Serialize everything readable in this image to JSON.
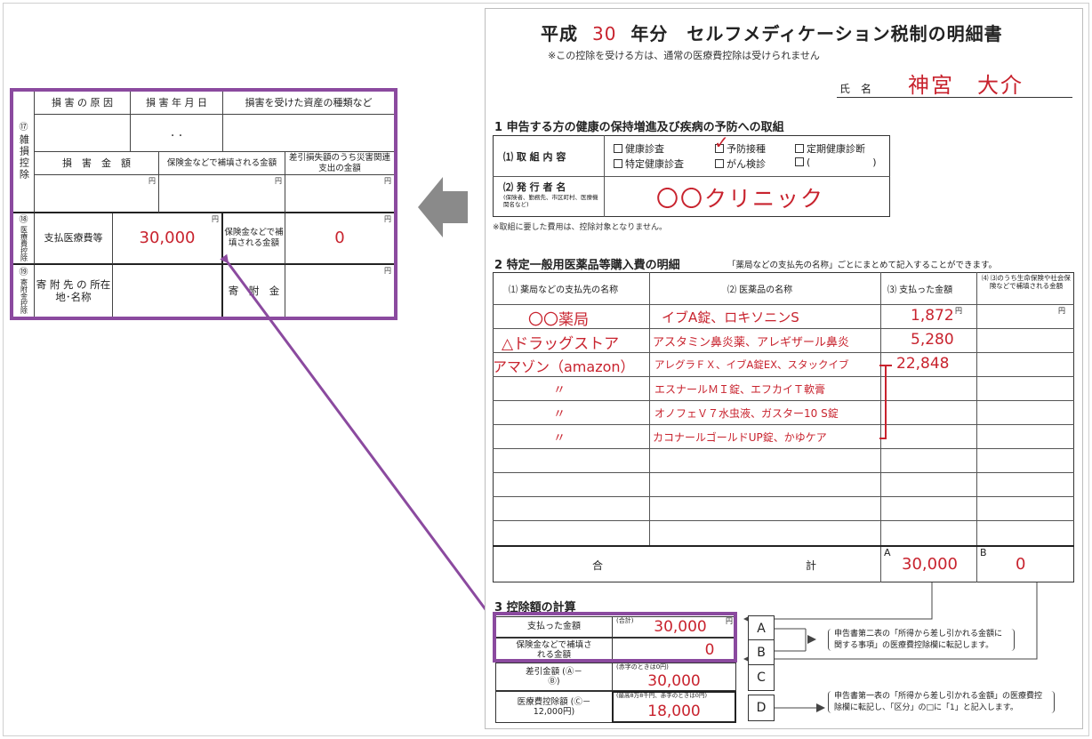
{
  "excerpt": {
    "row17": {
      "number": "⑰",
      "label": "雑損控除",
      "col_cause": "損 害 の 原 因",
      "col_date": "損 害 年 月 日",
      "col_asset": "損害を受けた資産の種類など",
      "date_placeholder": ".    .",
      "col_amount": "損　害　金　額",
      "col_insurance": "保険金などで補填される金額",
      "col_disaster": "差引損失額のうち災害関連支出の金額",
      "yen": "円"
    },
    "row18": {
      "number": "⑱",
      "label": "医療費控除",
      "paid_label": "支払医療費等",
      "paid_value": "30,000",
      "insurance_label": "保険金などで補填される金額",
      "insurance_value": "0",
      "yen": "円"
    },
    "row19": {
      "number": "⑲",
      "label": "寄附金控除",
      "address_label": "寄 附 先 の 所在地･名称",
      "donation_label": "寄　附　金",
      "yen": "円"
    }
  },
  "form": {
    "title_prefix": "平成",
    "title_year": "30",
    "title_suffix": "年分　セルフメディケーション税制の明細書",
    "subtitle": "※この控除を受ける方は、通常の医療費控除は受けられません",
    "name_label": "氏　名",
    "name_value": "神宮　大介",
    "section1": {
      "heading": "1  申告する方の健康の保持増進及び疾病の予防への取組",
      "row1_label": "⑴ 取 組 内 容",
      "options": [
        "健康診査",
        "予防接種",
        "定期健康診断",
        "特定健康診査",
        "がん検診",
        "(                    )"
      ],
      "checked": "予防接種",
      "row2_label": "⑵ 発 行 者 名",
      "row2_sub": "(保険者、勤務先、市区町村、医療機関名など)",
      "issuer_value": "〇〇クリニック",
      "footnote": "※取組に要した費用は、控除対象となりません。"
    },
    "section2": {
      "heading": "2  特定一般用医薬品等購入費の明細",
      "heading_note": "「薬局などの支払先の名称」ごとにまとめて記入することができます。",
      "col1": "⑴ 薬局などの支払先の名称",
      "col2": "⑵ 医薬品の名称",
      "col3": "⑶ 支払った金額",
      "col4": "⑷ ⑶のうち生命保険や社会保険などで補填される金額",
      "yen": "円",
      "rows": [
        {
          "store": "〇〇薬局",
          "medicine": "イブA錠、ロキソニンS",
          "amount": "1,872"
        },
        {
          "store": "△ドラッグストア",
          "medicine": "アスタミン鼻炎薬、アレギザール鼻炎",
          "amount": "5,280"
        },
        {
          "store": "アマゾン（amazon）",
          "medicine": "アレグラＦＸ、イブA錠EX、スタックイブ",
          "amount": "22,848"
        },
        {
          "store": "〃",
          "medicine": "エスナールＭＩ錠、エフカイＴ軟膏",
          "amount": ""
        },
        {
          "store": "〃",
          "medicine": "オノフェＶ７水虫液、ガスター10 S錠",
          "amount": ""
        },
        {
          "store": "〃",
          "medicine": "カコナールゴールドUP錠、かゆケア",
          "amount": ""
        }
      ],
      "total_label_left": "合",
      "total_label_right": "計",
      "total_a_letter": "A",
      "total_a": "30,000",
      "total_b_letter": "B",
      "total_b": "0"
    },
    "section3": {
      "heading": "3  控除額の計算",
      "paid_label": "支払った金額",
      "paid_small": "(合計)",
      "paid_value": "30,000",
      "yen": "円",
      "insurance_label": "保険金などで補填される金額",
      "insurance_value": "0",
      "diff_label": "差引金額 (Ⓐ－Ⓑ)",
      "diff_small": "(赤字のときは0円)",
      "diff_value": "30,000",
      "deduct_label": "医療費控除額 (Ⓒ－12,000円)",
      "deduct_small": "(最高8万8千円、赤字のときは0円)",
      "deduct_value": "18,000",
      "letters": [
        "A",
        "B",
        "C",
        "D"
      ],
      "note_ab": "申告書第二表の「所得から差し引かれる金額に関する事項」の医療費控除欄に転記します。",
      "note_d": "申告書第一表の「所得から差し引かれる金額」の医療費控除欄に転記し、「区分」の□に「1」と記入します。"
    }
  },
  "colors": {
    "highlight": "#8b4a9f",
    "handwriting": "#c8232e",
    "arrow": "#8a8a8a"
  }
}
